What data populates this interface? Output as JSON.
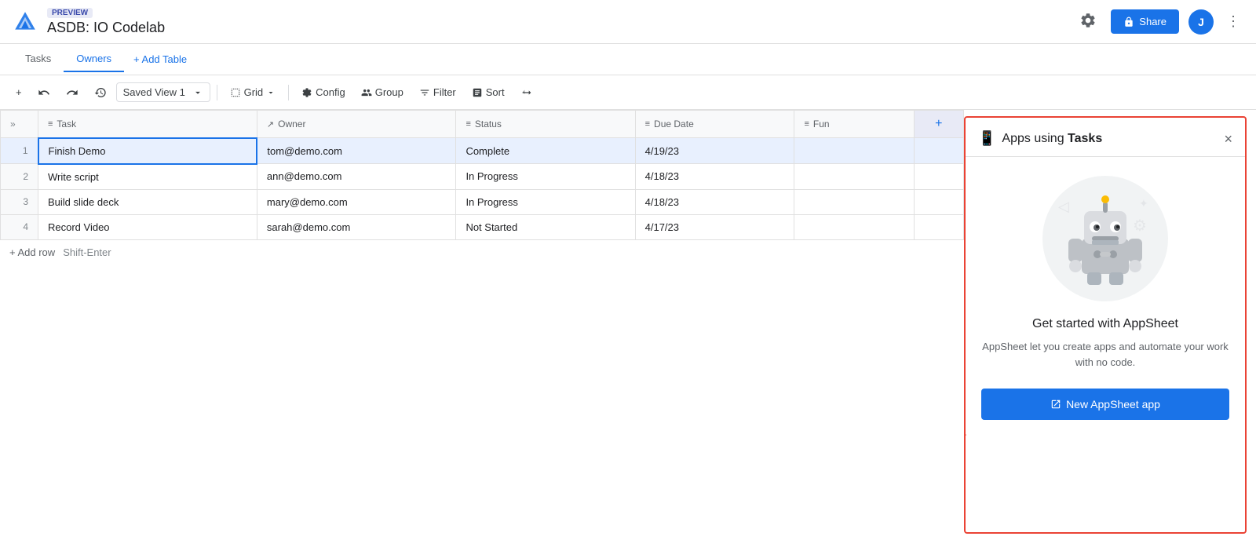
{
  "header": {
    "preview_label": "PREVIEW",
    "app_title": "ASDB: IO Codelab",
    "share_label": "Share",
    "avatar_letter": "J",
    "gear_icon": "⚙",
    "more_icon": "⋮"
  },
  "tabs": [
    {
      "label": "Tasks",
      "active": false
    },
    {
      "label": "Owners",
      "active": true
    }
  ],
  "add_table_label": "+ Add Table",
  "toolbar": {
    "add_icon": "+",
    "undo_icon": "↺",
    "redo_icon": "↻",
    "history_icon": "🕐",
    "view_selector_label": "Saved View 1",
    "grid_label": "Grid",
    "config_label": "Config",
    "group_label": "Group",
    "filter_label": "Filter",
    "sort_label": "Sort",
    "extra_icon": "⇅"
  },
  "table": {
    "columns": [
      {
        "icon": "≡",
        "label": "Task"
      },
      {
        "icon": "↗",
        "label": "Owner"
      },
      {
        "icon": "≡",
        "label": "Status"
      },
      {
        "icon": "≡",
        "label": "Due Date"
      },
      {
        "icon": "≡",
        "label": "Fun"
      }
    ],
    "rows": [
      {
        "num": "1",
        "task": "Finish Demo",
        "owner": "tom@demo.com",
        "status": "Complete",
        "due_date": "4/19/23",
        "fun": "",
        "selected": true
      },
      {
        "num": "2",
        "task": "Write script",
        "owner": "ann@demo.com",
        "status": "In Progress",
        "due_date": "4/18/23",
        "fun": "",
        "selected": false
      },
      {
        "num": "3",
        "task": "Build slide deck",
        "owner": "mary@demo.com",
        "status": "In Progress",
        "due_date": "4/18/23",
        "fun": "",
        "selected": false
      },
      {
        "num": "4",
        "task": "Record Video",
        "owner": "sarah@demo.com",
        "status": "Not Started",
        "due_date": "4/17/23",
        "fun": "",
        "selected": false
      }
    ],
    "add_row_label": "+ Add row",
    "add_row_hint": "Shift-Enter"
  },
  "panel": {
    "phone_icon": "📱",
    "title_prefix": "Apps using ",
    "title_bold": "Tasks",
    "close_icon": "×",
    "heading": "Get started with AppSheet",
    "description": "AppSheet let you create apps and automate your work with no code.",
    "new_app_label": "New AppSheet app",
    "new_app_icon": "⎋"
  }
}
